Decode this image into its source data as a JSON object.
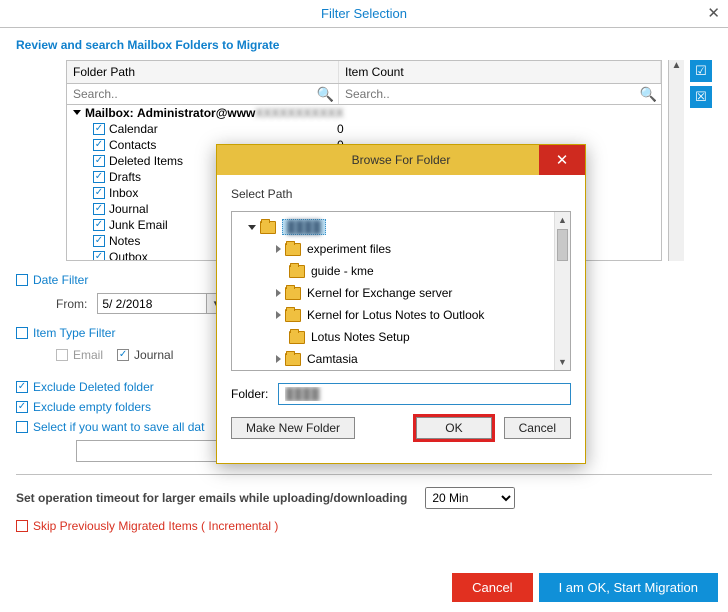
{
  "titlebar": {
    "title": "Filter Selection"
  },
  "heading": "Review and search Mailbox Folders to Migrate",
  "folder_table": {
    "headers": {
      "path": "Folder Path",
      "count": "Item Count"
    },
    "search_placeholder": "Search..",
    "mailbox_prefix": "Mailbox",
    "mailbox_label": "Administrator@www",
    "rows": [
      {
        "name": "Calendar",
        "count": "0"
      },
      {
        "name": "Contacts",
        "count": "0"
      },
      {
        "name": "Deleted Items",
        "count": ""
      },
      {
        "name": "Drafts",
        "count": ""
      },
      {
        "name": "Inbox",
        "count": ""
      },
      {
        "name": "Journal",
        "count": ""
      },
      {
        "name": "Junk Email",
        "count": ""
      },
      {
        "name": "Notes",
        "count": ""
      },
      {
        "name": "Outbox",
        "count": ""
      }
    ]
  },
  "date_filter": {
    "label": "Date Filter",
    "from_label": "From:",
    "from_value": "5/ 2/2018"
  },
  "item_type_filter": {
    "label": "Item Type Filter",
    "types": {
      "email": "Email",
      "journal": "Journal"
    }
  },
  "checks": {
    "exclude_deleted": "Exclude Deleted folder",
    "exclude_empty": "Exclude empty folders",
    "save_all": "Select if you want to save all dat"
  },
  "timeout": {
    "label": "Set operation timeout for larger emails while uploading/downloading",
    "value": "20 Min"
  },
  "skip": "Skip Previously Migrated Items ( Incremental )",
  "bottom": {
    "cancel": "Cancel",
    "start": "I am OK, Start Migration"
  },
  "modal": {
    "title": "Browse For Folder",
    "subtitle": "Select Path",
    "root_label": "████",
    "tree": [
      {
        "label": "experiment files",
        "expandable": true
      },
      {
        "label": "guide - kme",
        "expandable": false
      },
      {
        "label": "Kernel for Exchange server",
        "expandable": true
      },
      {
        "label": "Kernel for Lotus Notes to Outlook",
        "expandable": true
      },
      {
        "label": "Lotus Notes Setup",
        "expandable": false
      },
      {
        "label": "Camtasia",
        "expandable": true
      }
    ],
    "folder_label": "Folder:",
    "folder_value": "████",
    "buttons": {
      "new": "Make New Folder",
      "ok": "OK",
      "cancel": "Cancel"
    }
  }
}
